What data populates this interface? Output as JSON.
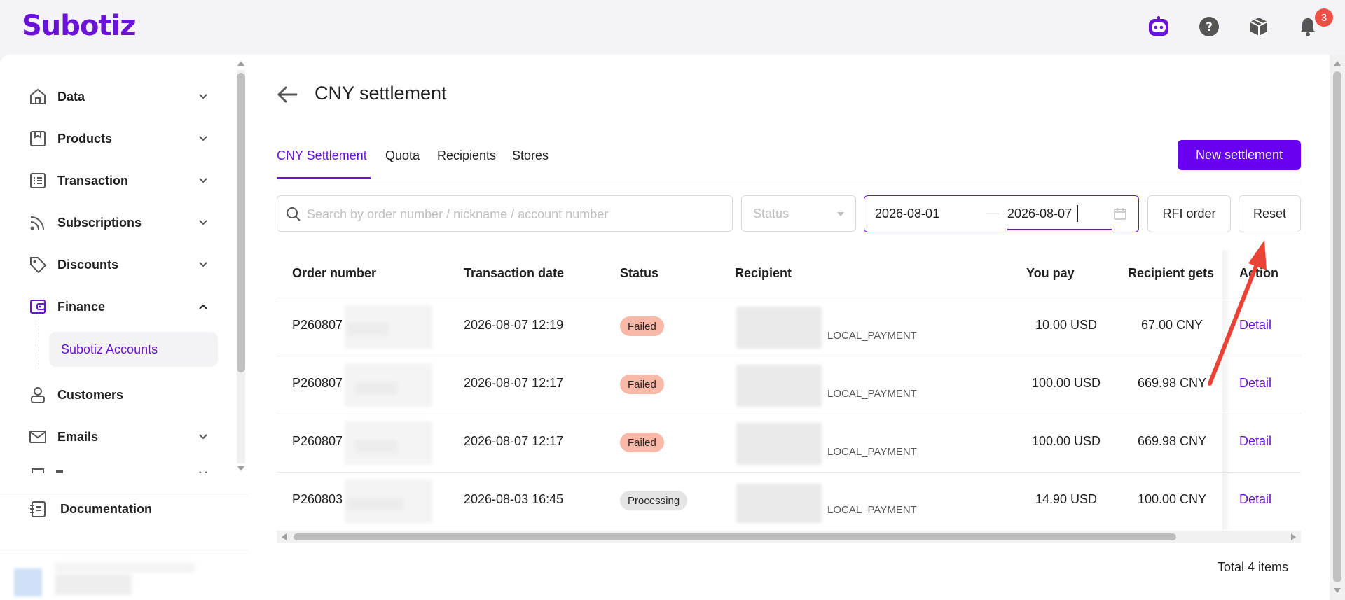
{
  "app": {
    "logo": "Subotiz",
    "notification_count": "3"
  },
  "sidebar": {
    "items": [
      {
        "label": "Data",
        "icon": "home-icon",
        "expanded": false
      },
      {
        "label": "Products",
        "icon": "box-icon",
        "expanded": false
      },
      {
        "label": "Transaction",
        "icon": "list-icon",
        "expanded": false
      },
      {
        "label": "Subscriptions",
        "icon": "rss-icon",
        "expanded": false
      },
      {
        "label": "Discounts",
        "icon": "tag-icon",
        "expanded": false
      },
      {
        "label": "Finance",
        "icon": "wallet-icon",
        "expanded": true
      },
      {
        "label": "Customers",
        "icon": "user-icon",
        "expanded": false
      },
      {
        "label": "Emails",
        "icon": "mail-icon",
        "expanded": false
      }
    ],
    "finance_sub": "Subotiz Accounts",
    "documentation": "Documentation"
  },
  "page": {
    "title": "CNY settlement",
    "tabs": [
      "CNY Settlement",
      "Quota",
      "Recipients",
      "Stores"
    ],
    "active_tab": "CNY Settlement",
    "new_button": "New settlement"
  },
  "filters": {
    "search_placeholder": "Search by order number / nickname / account number",
    "status_placeholder": "Status",
    "date_start": "2026-08-01",
    "date_separator": "—",
    "date_end": "2026-08-07",
    "rfi_button": "RFI order",
    "reset_button": "Reset"
  },
  "table": {
    "headers": {
      "order": "Order number",
      "date": "Transaction date",
      "status": "Status",
      "recipient": "Recipient",
      "you_pay": "You pay",
      "gets": "Recipient gets",
      "action": "Action"
    },
    "rows": [
      {
        "order": "P260807",
        "date": "2026-08-07 12:19",
        "status": "Failed",
        "recipient_type": "LOCAL_PAYMENT",
        "you_pay": "10.00 USD",
        "gets": "67.00 CNY",
        "action": "Detail"
      },
      {
        "order": "P260807",
        "date": "2026-08-07 12:17",
        "status": "Failed",
        "recipient_type": "LOCAL_PAYMENT",
        "you_pay": "100.00 USD",
        "gets": "669.98 CNY",
        "action": "Detail"
      },
      {
        "order": "P260807",
        "date": "2026-08-07 12:17",
        "status": "Failed",
        "recipient_type": "LOCAL_PAYMENT",
        "you_pay": "100.00 USD",
        "gets": "669.98 CNY",
        "action": "Detail"
      },
      {
        "order": "P260803",
        "date": "2026-08-03 16:45",
        "status": "Processing",
        "recipient_type": "LOCAL_PAYMENT",
        "you_pay": "14.90 USD",
        "gets": "100.00 CNY",
        "action": "Detail"
      }
    ]
  },
  "footer": {
    "total": "Total 4 items"
  },
  "colors": {
    "brand": "#6a12d6",
    "button": "#6a00f0",
    "failed": "#f9b9a8",
    "processing": "#e4e4e4",
    "annotation": "#ea4335"
  }
}
